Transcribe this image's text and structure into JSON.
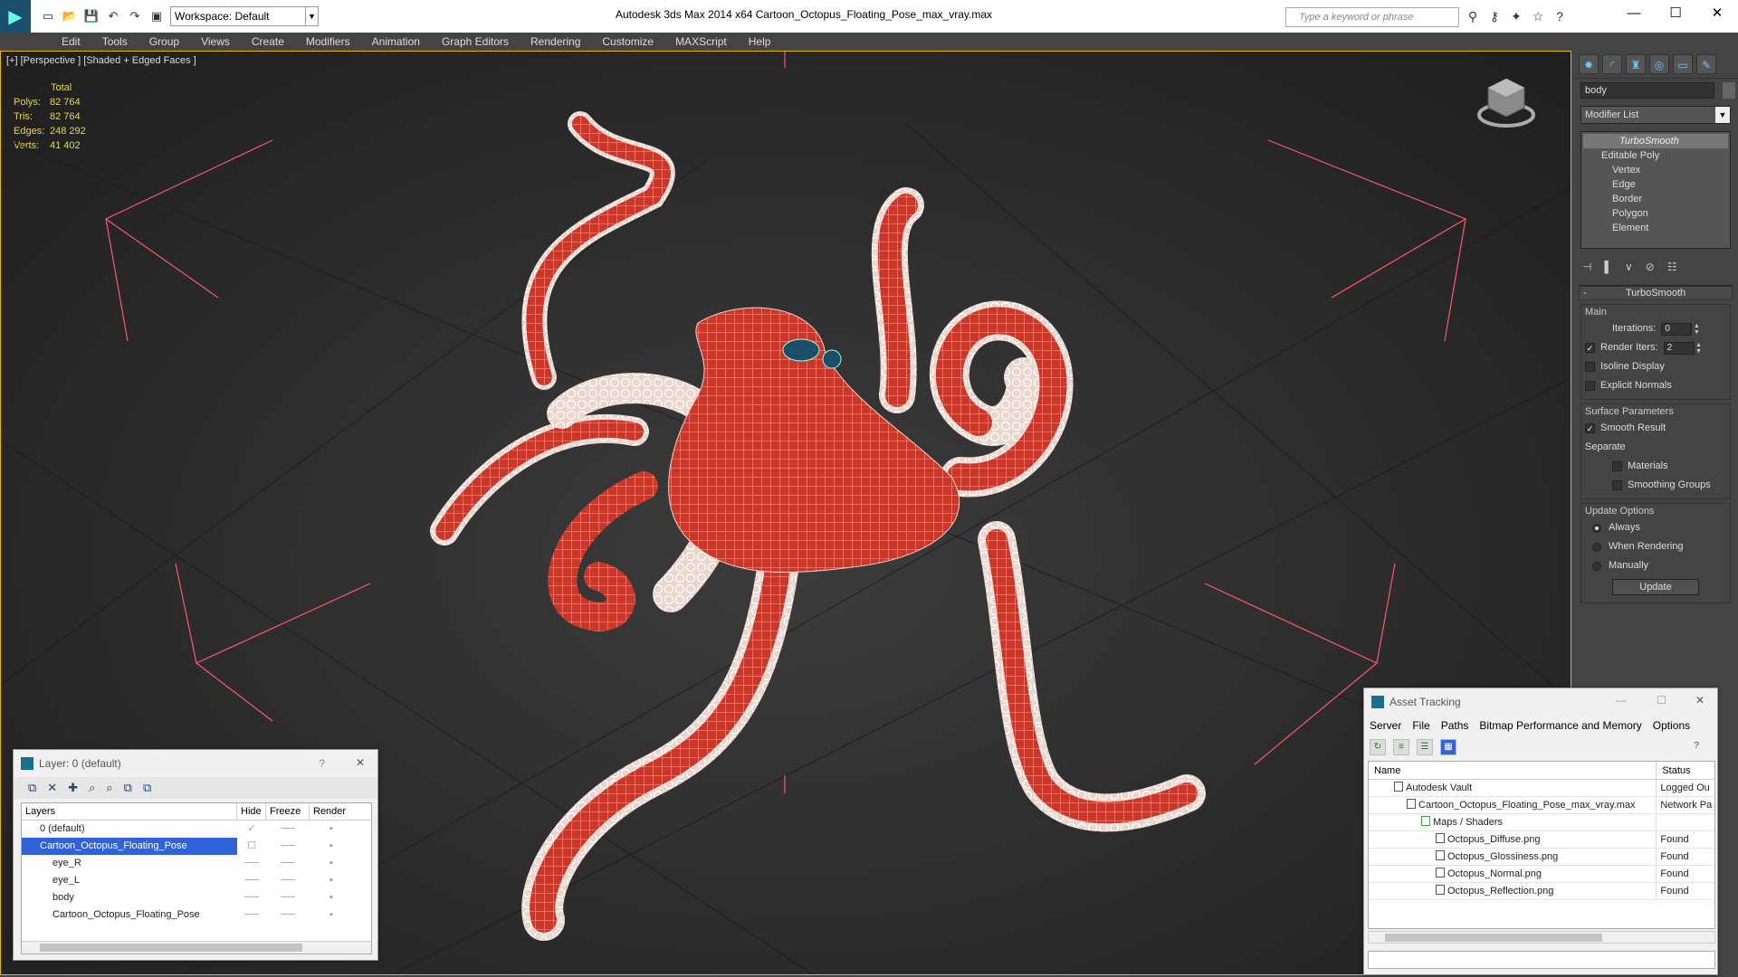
{
  "window": {
    "title": "Autodesk 3ds Max  2014 x64     Cartoon_Octopus_Floating_Pose_max_vray.max",
    "workspace": "Workspace: Default",
    "search_placeholder": "Type a keyword or phrase"
  },
  "menu": [
    "Edit",
    "Tools",
    "Group",
    "Views",
    "Create",
    "Modifiers",
    "Animation",
    "Graph Editors",
    "Rendering",
    "Customize",
    "MAXScript",
    "Help"
  ],
  "viewport": {
    "label": "[+] [Perspective ] [Shaded + Edged Faces ]",
    "stats": {
      "header": "Total",
      "rows": [
        {
          "k": "Polys:",
          "v": "82 764"
        },
        {
          "k": "Tris:",
          "v": "82 764"
        },
        {
          "k": "Edges:",
          "v": "248 292"
        },
        {
          "k": "Verts:",
          "v": "41 402"
        }
      ]
    }
  },
  "command_panel": {
    "object_name": "body",
    "modifier_list": "Modifier List",
    "stack": {
      "turbosmooth": "TurboSmooth",
      "editable_poly": "Editable Poly",
      "sub": [
        "Vertex",
        "Edge",
        "Border",
        "Polygon",
        "Element"
      ]
    },
    "rollout_title": "TurboSmooth",
    "main_group": "Main",
    "iterations_label": "Iterations:",
    "iterations_value": "0",
    "render_iters_label": "Render Iters:",
    "render_iters_value": "2",
    "isoline": "Isoline Display",
    "explicit_normals": "Explicit Normals",
    "surface_group": "Surface Parameters",
    "smooth_result": "Smooth Result",
    "separate": "Separate",
    "materials": "Materials",
    "smoothing_groups": "Smoothing Groups",
    "update_group": "Update Options",
    "always": "Always",
    "when_rendering": "When Rendering",
    "manually": "Manually",
    "update_button": "Update"
  },
  "layer_dialog": {
    "title": "Layer: 0 (default)",
    "help": "?",
    "close": "✕",
    "columns": [
      "Layers",
      "Hide",
      "Freeze",
      "Render"
    ],
    "rows": [
      {
        "name": "0 (default)",
        "indent": 0
      },
      {
        "name": "Cartoon_Octopus_Floating_Pose",
        "indent": 0,
        "selected": true
      },
      {
        "name": "eye_R",
        "indent": 1
      },
      {
        "name": "eye_L",
        "indent": 1
      },
      {
        "name": "body",
        "indent": 1
      },
      {
        "name": "Cartoon_Octopus_Floating_Pose",
        "indent": 1
      }
    ]
  },
  "asset_dialog": {
    "title": "Asset Tracking",
    "menu": [
      "Server",
      "File",
      "Paths",
      "Bitmap Performance and Memory",
      "Options"
    ],
    "columns": [
      "Name",
      "Status"
    ],
    "rows": [
      {
        "name": "Autodesk Vault",
        "status": "Logged Ou",
        "indent": 1
      },
      {
        "name": "Cartoon_Octopus_Floating_Pose_max_vray.max",
        "status": "Network Pa",
        "indent": 2
      },
      {
        "name": "Maps / Shaders",
        "status": "",
        "indent": 3
      },
      {
        "name": "Octopus_Diffuse.png",
        "status": "Found",
        "indent": 4
      },
      {
        "name": "Octopus_Glossiness.png",
        "status": "Found",
        "indent": 4
      },
      {
        "name": "Octopus_Normal.png",
        "status": "Found",
        "indent": 4
      },
      {
        "name": "Octopus_Reflection.png",
        "status": "Found",
        "indent": 4
      }
    ]
  },
  "colors": {
    "accent": "#e8b800",
    "octopus": "#c8382a",
    "stats": "#e8d840",
    "selection": "#3063d8"
  }
}
